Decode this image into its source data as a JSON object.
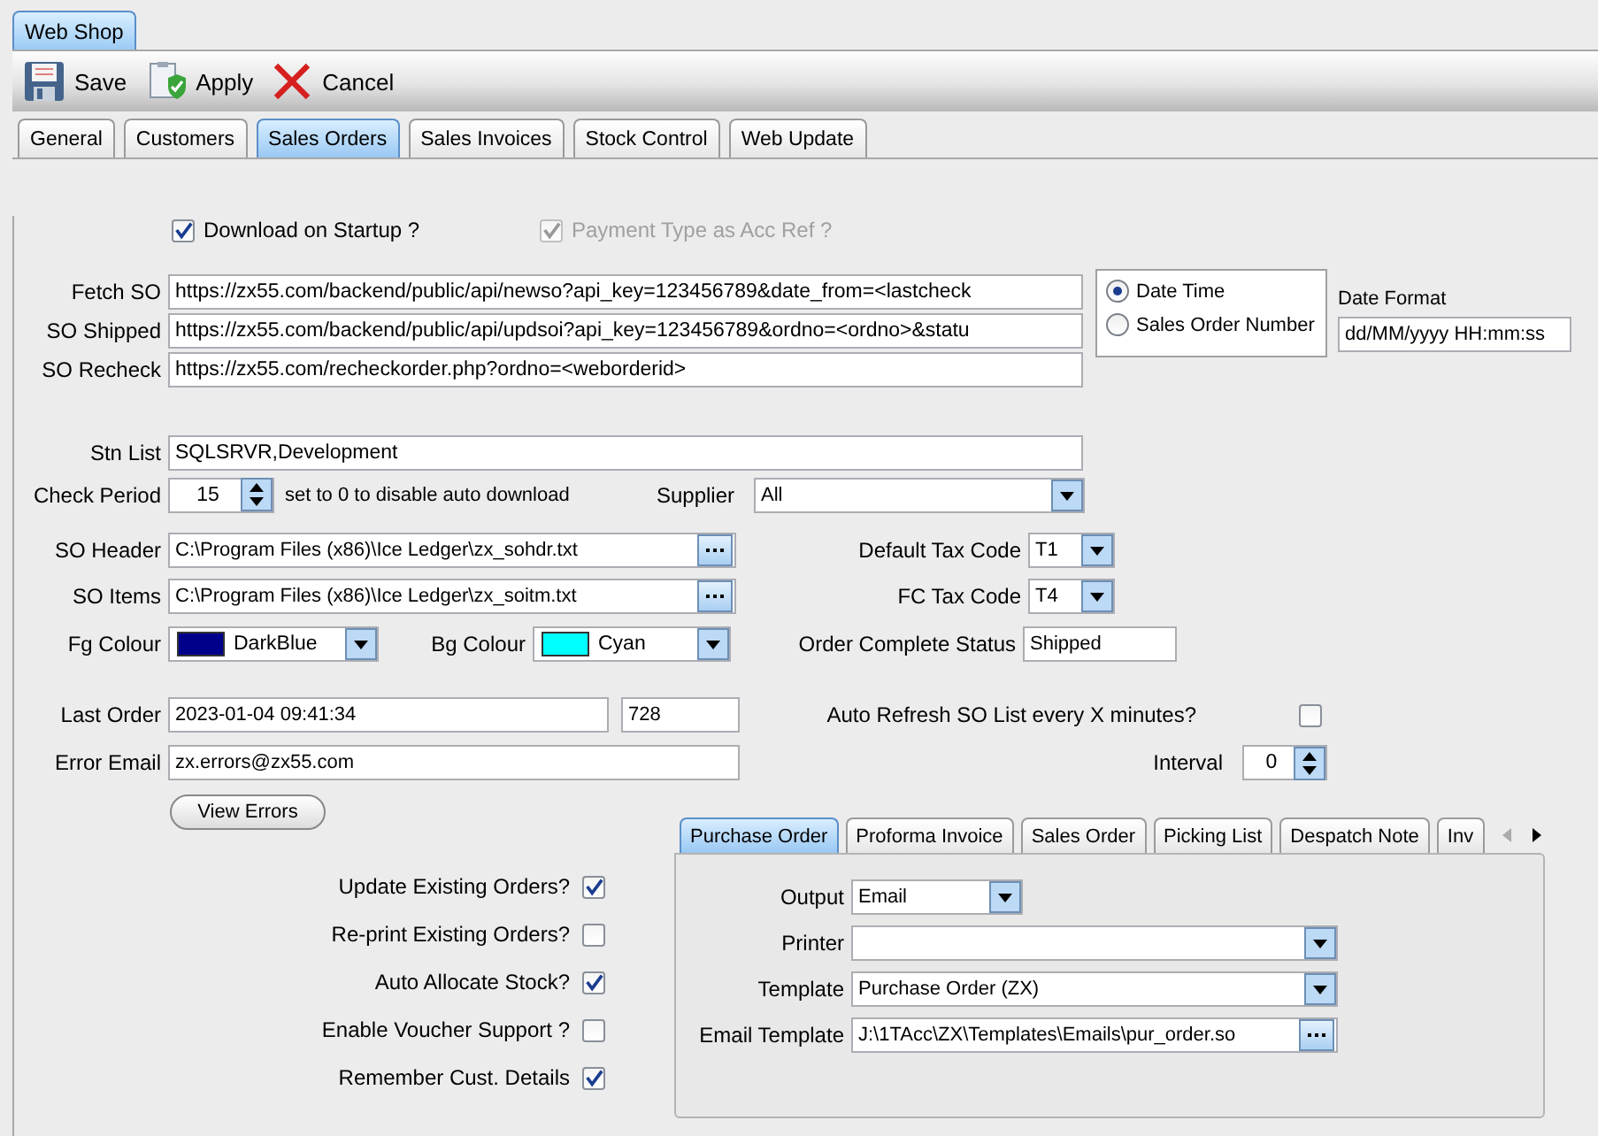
{
  "app_tab": {
    "label": "Web Shop",
    "selected": true
  },
  "toolbar": [
    {
      "kind": "save",
      "label": "Save"
    },
    {
      "kind": "apply",
      "label": "Apply"
    },
    {
      "kind": "cancel",
      "label": "Cancel"
    }
  ],
  "tabs": [
    {
      "label": "General",
      "selected": false
    },
    {
      "label": "Customers",
      "selected": false
    },
    {
      "label": "Sales Orders",
      "selected": true
    },
    {
      "label": "Sales Invoices",
      "selected": false
    },
    {
      "label": "Stock Control",
      "selected": false
    },
    {
      "label": "Web Update",
      "selected": false
    }
  ],
  "options": [
    {
      "label": "Download on Startup ?",
      "checked": true,
      "disabled": false
    },
    {
      "label": "Payment Type as Acc Ref ?",
      "checked": true,
      "disabled": true
    }
  ],
  "urls": [
    {
      "label": "Fetch SO",
      "value": "https://zx55.com/backend/public/api/newso?api_key=123456789&date_from=<lastcheck"
    },
    {
      "label": "SO Shipped",
      "value": "https://zx55.com/backend/public/api/updsoi?api_key=123456789&ordno=<ordno>&statu"
    },
    {
      "label": "SO Recheck",
      "value": "https://zx55.com/recheckorder.php?ordno=<weborderid>"
    }
  ],
  "date_mode": [
    {
      "label": "Date  Time",
      "selected": true
    },
    {
      "label": "Sales Order Number",
      "selected": false
    }
  ],
  "date_format": {
    "label": "Date Format",
    "value": "dd/MM/yyyy HH:mm:ss"
  },
  "stn_list": {
    "label": "Stn List",
    "value": "SQLSRVR,Development"
  },
  "check_period": {
    "label": "Check Period",
    "value": "15",
    "hint": "set to 0 to disable auto download"
  },
  "supplier": {
    "label": "Supplier",
    "value": "All"
  },
  "files": [
    {
      "label": "SO Header",
      "value": "C:\\Program Files (x86)\\Ice Ledger\\zx_sohdr.txt"
    },
    {
      "label": "SO Items",
      "value": "C:\\Program Files (x86)\\Ice Ledger\\zx_soitm.txt"
    }
  ],
  "tax_codes": [
    {
      "label": "Default Tax Code",
      "value": "T1"
    },
    {
      "label": "FC Tax Code",
      "value": "T4"
    }
  ],
  "colours": [
    {
      "label": "Fg Colour",
      "value": "DarkBlue",
      "color": "#00008b"
    },
    {
      "label": "Bg Colour",
      "value": "Cyan",
      "color": "#00ffff"
    }
  ],
  "order_complete_status": {
    "label": "Order Complete Status",
    "value": "Shipped"
  },
  "last_order": {
    "label": "Last Order",
    "value": "2023-01-04 09:41:34",
    "number": "728"
  },
  "auto_refresh": {
    "label": "Auto Refresh SO List every X minutes?",
    "checked": false
  },
  "error_email": {
    "label": "Error Email",
    "value": "zx.errors@zx55.com"
  },
  "interval": {
    "label": "Interval",
    "value": "0"
  },
  "view_errors_button": "View Errors",
  "order_options": [
    {
      "label": "Update Existing Orders?",
      "checked": true
    },
    {
      "label": "Re-print Existing Orders?",
      "checked": false
    },
    {
      "label": "Auto Allocate Stock?",
      "checked": true
    },
    {
      "label": "Enable Voucher Support ?",
      "checked": false
    },
    {
      "label": "Remember Cust. Details",
      "checked": true
    }
  ],
  "doc_tabs": [
    {
      "label": "Purchase Order",
      "selected": true
    },
    {
      "label": "Proforma Invoice",
      "selected": false
    },
    {
      "label": "Sales Order",
      "selected": false
    },
    {
      "label": "Picking List",
      "selected": false
    },
    {
      "label": "Despatch Note",
      "selected": false
    },
    {
      "label": "Inv",
      "selected": false
    }
  ],
  "doc_settings": [
    {
      "label": "Output",
      "kind": "select",
      "value": "Email"
    },
    {
      "label": "Printer",
      "kind": "select"
    },
    {
      "label": "Template",
      "kind": "select",
      "value": "Purchase Order (ZX)"
    },
    {
      "label": "Email Template",
      "kind": "file",
      "value": "J:\\1TAcc\\ZX\\Templates\\Emails\\pur_order.so"
    }
  ]
}
